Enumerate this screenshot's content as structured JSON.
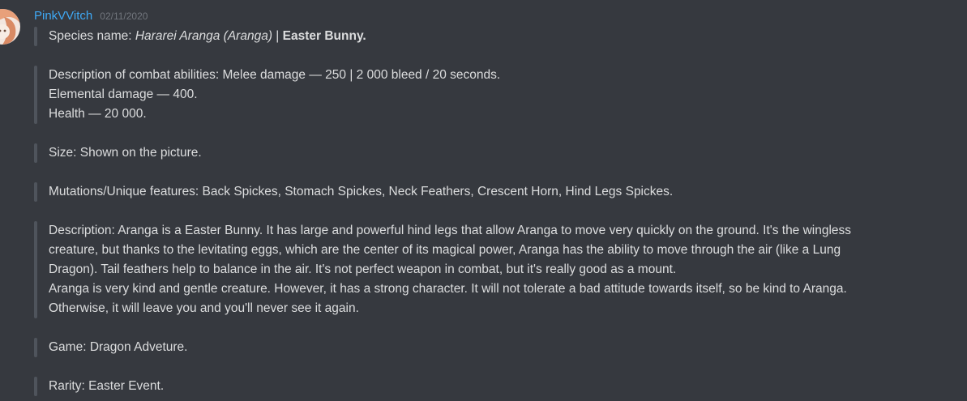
{
  "user": {
    "name": "PinkVVitch",
    "timestamp": "02/11/2020"
  },
  "blocks": {
    "species": {
      "label": "Species name: ",
      "italic": "Hararei Aranga (Aranga)",
      "separator": " | ",
      "bold": "Easter Bunny."
    },
    "combat": {
      "line1": "Description of combat abilities: Melee damage — 250 | 2 000 bleed / 20 seconds.",
      "line2": "Elemental damage — 400.",
      "line3": "Health — 20 000."
    },
    "size": "Size: Shown on the picture.",
    "mutations": "Mutations/Unique features: Back Spickes, Stomach Spickes, Neck Feathers, Crescent Horn, Hind Legs Spickes.",
    "description": {
      "line1": "Description: Aranga is a Easter Bunny. It has large and powerful hind legs that allow Aranga to move very quickly on the ground. It's the wingless",
      "line2": "creature, but thanks to the levitating eggs, which are the center of its magical power, Aranga has the ability to move through the air (like a Lung",
      "line3": "Dragon). Tail feathers help to balance in the air. It's not perfect weapon in combat, but it's really good as a mount.",
      "line4": "Aranga is very kind and gentle creature. However, it has a strong character. It will not tolerate a bad attitude towards itself, so be kind to Aranga.",
      "line5": "Otherwise, it will leave you and you'll never see it again."
    },
    "game": "Game: Dragon Adveture.",
    "rarity": "Rarity: Easter Event."
  },
  "colors": {
    "background": "#36393f",
    "username": "#3fa9f5",
    "text": "#dcddde",
    "timestamp": "#72767d",
    "quote_bar": "#4f545c"
  },
  "icons": {
    "avatar": "user-avatar-icon"
  }
}
